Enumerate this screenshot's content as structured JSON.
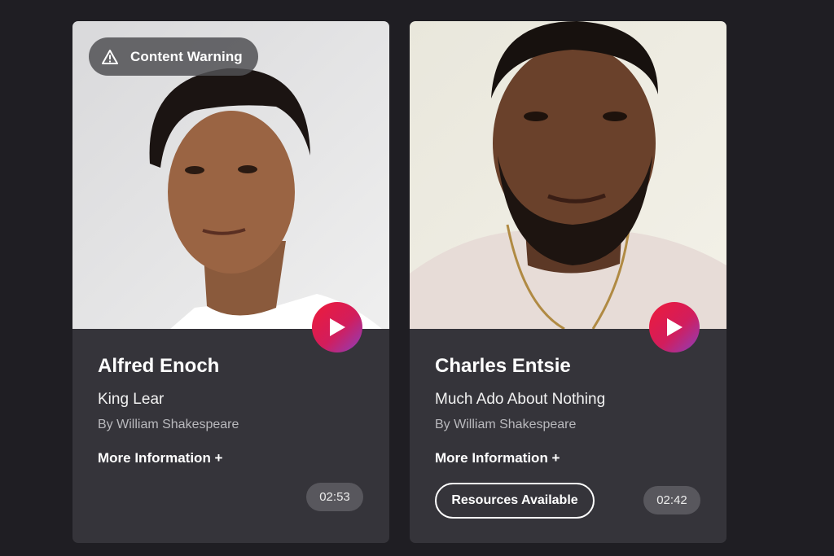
{
  "colors": {
    "background": "#1f1e23",
    "card": "#35343a",
    "play_gradient_start": "#ee1b3a",
    "play_gradient_end": "#8a3fbf",
    "badge": "#58575d"
  },
  "cards": [
    {
      "content_warning": "Content Warning",
      "warning_icon": "warning-triangle-icon",
      "play_icon": "play-icon",
      "actor": "Alfred Enoch",
      "play": "King Lear",
      "author": "By William Shakespeare",
      "more_info": "More Information +",
      "duration": "02:53"
    },
    {
      "play_icon": "play-icon",
      "actor": "Charles Entsie",
      "play": "Much Ado About Nothing",
      "author": "By William Shakespeare",
      "more_info": "More Information +",
      "resources": "Resources Available",
      "duration": "02:42"
    }
  ]
}
